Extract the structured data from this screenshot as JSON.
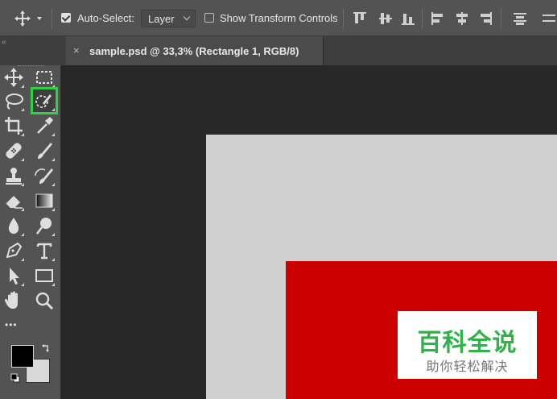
{
  "options_bar": {
    "tool_icon": "move-tool-icon",
    "auto_select_label": "Auto-Select:",
    "auto_select_checked": true,
    "auto_select_target": "Layer",
    "show_transform_controls_label": "Show Transform Controls",
    "show_transform_checked": false,
    "align_icons": [
      "align-top-edges-icon",
      "align-vertical-centers-icon",
      "align-bottom-edges-icon",
      "align-left-edges-icon",
      "align-horizontal-centers-icon",
      "align-right-edges-icon",
      "distribute-top-icon"
    ]
  },
  "document_tab": {
    "title": "sample.psd @ 33,3% (Rectangle 1, RGB/8)",
    "close_glyph": "×"
  },
  "toolbar": {
    "collapse_glyph": "‹‹",
    "more_glyph": "•••",
    "selected_tool": "quick-selection-tool",
    "highlight_color": "#2ed142",
    "tools": [
      "move-tool-icon",
      "rectangular-marquee-icon",
      "lasso-icon",
      "quick-selection-icon",
      "crop-icon",
      "eyedropper-icon",
      "healing-brush-icon",
      "brush-icon",
      "clone-stamp-icon",
      "history-brush-icon",
      "eraser-icon",
      "gradient-icon",
      "blur-icon",
      "dodge-icon",
      "pen-icon",
      "type-icon",
      "path-selection-icon",
      "rectangle-shape-icon",
      "hand-icon",
      "zoom-icon"
    ],
    "foreground_color": "#000000",
    "background_color": "#d9d9d9"
  },
  "canvas": {
    "background": "#282828",
    "document_color": "#d0d0d0",
    "rectangle_color": "#cc0000"
  },
  "watermark": {
    "title": "百科全说",
    "subtitle": "助你轻松解决"
  }
}
